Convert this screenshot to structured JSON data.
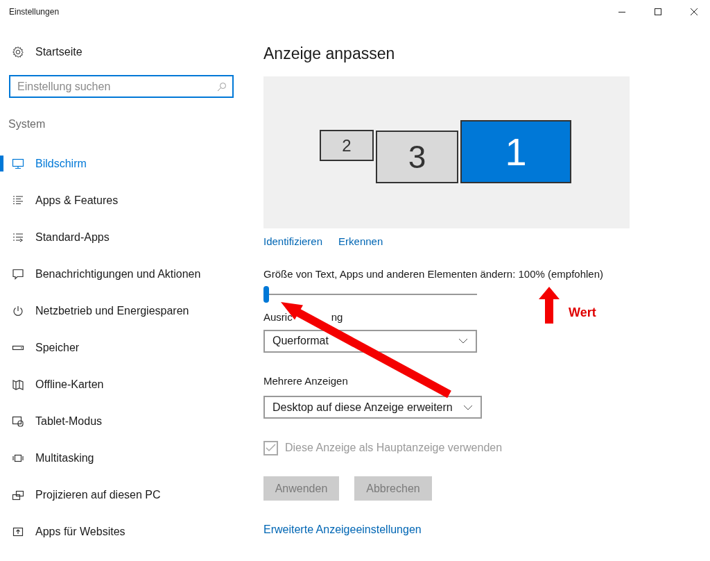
{
  "window": {
    "title": "Einstellungen"
  },
  "sidebar": {
    "home": "Startseite",
    "search": {
      "placeholder": "Einstellung suchen"
    },
    "section": "System",
    "items": [
      {
        "label": "Bildschirm",
        "selected": true
      },
      {
        "label": "Apps & Features",
        "selected": false
      },
      {
        "label": "Standard-Apps",
        "selected": false
      },
      {
        "label": "Benachrichtigungen und Aktionen",
        "selected": false
      },
      {
        "label": "Netzbetrieb und Energiesparen",
        "selected": false
      },
      {
        "label": "Speicher",
        "selected": false
      },
      {
        "label": "Offline-Karten",
        "selected": false
      },
      {
        "label": "Tablet-Modus",
        "selected": false
      },
      {
        "label": "Multitasking",
        "selected": false
      },
      {
        "label": "Projizieren auf diesen PC",
        "selected": false
      },
      {
        "label": "Apps für Websites",
        "selected": false
      }
    ]
  },
  "main": {
    "title": "Anzeige anpassen",
    "displays": [
      {
        "label": "2",
        "selected": false
      },
      {
        "label": "3",
        "selected": false
      },
      {
        "label": "1",
        "selected": true
      }
    ],
    "links": [
      "Identifizieren",
      "Erkennen"
    ],
    "scale": {
      "label": "Größe von Text, Apps und anderen Elementen ändern: 100% (empfohlen)",
      "level": 0
    },
    "orientation": {
      "label_parts": [
        "Ausric",
        "ng"
      ],
      "value": "Querformat"
    },
    "multiple_displays": {
      "label": "Mehrere Anzeigen",
      "value": "Desktop auf diese Anzeige erweitern"
    },
    "main_display": {
      "label": "Diese Anzeige als Hauptanzeige verwenden",
      "checked": true,
      "disabled": true
    },
    "buttons": [
      {
        "label": "Anwenden",
        "disabled": true
      },
      {
        "label": "Abbrechen",
        "disabled": true
      }
    ],
    "advanced_link": "Erweiterte Anzeigeeinstellungen"
  },
  "annotation": {
    "label": "Wert"
  }
}
